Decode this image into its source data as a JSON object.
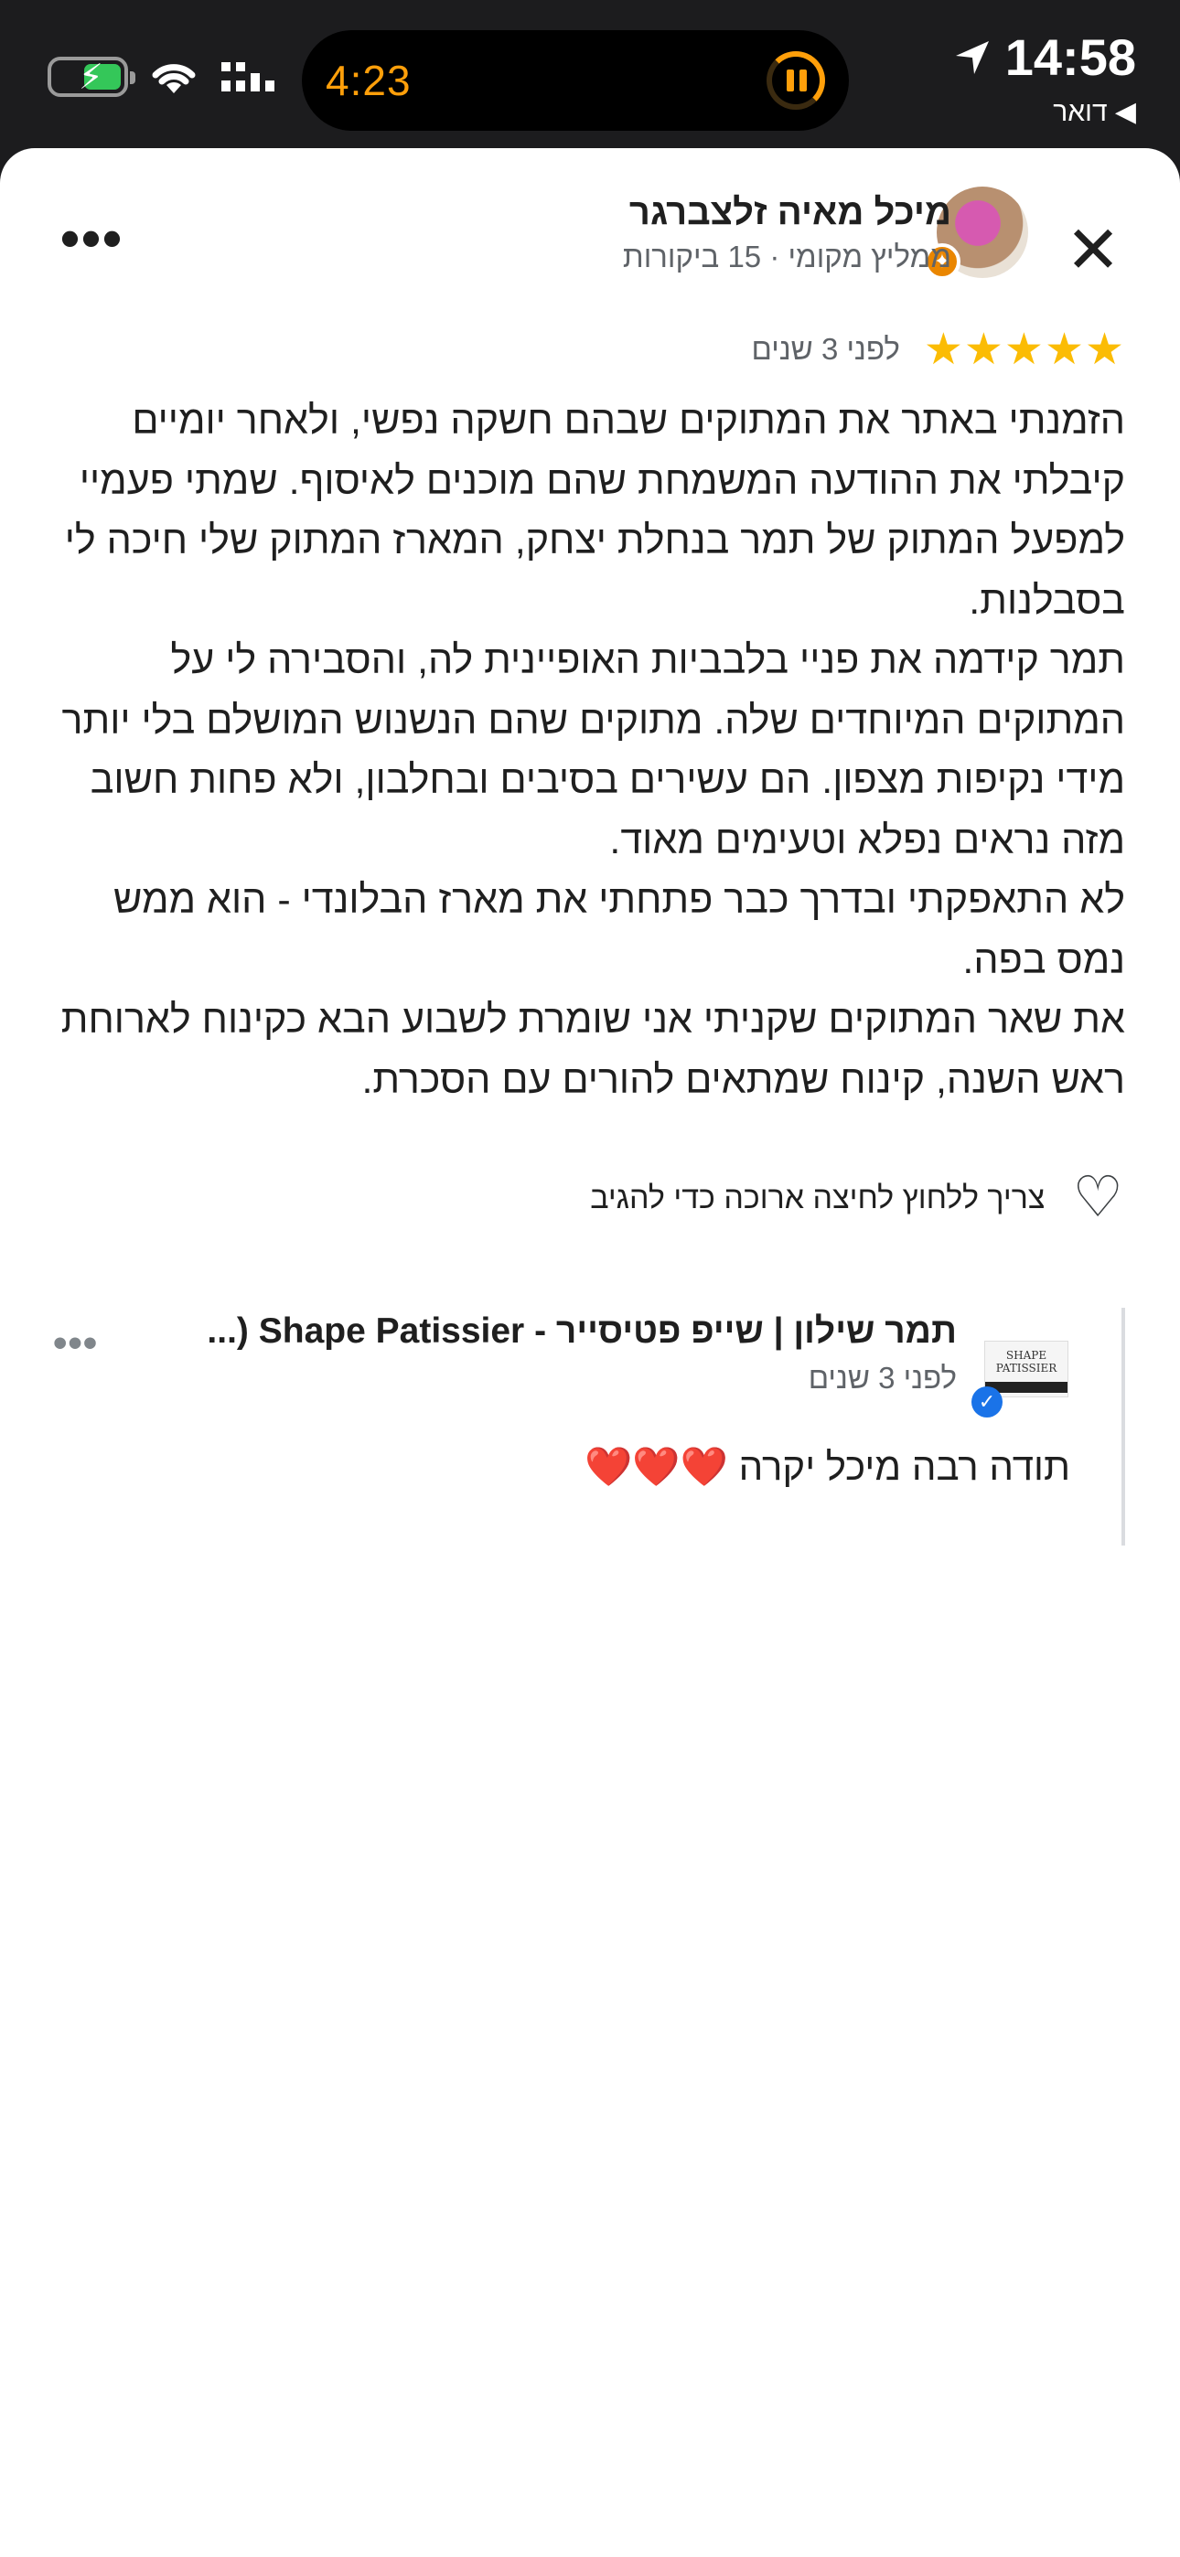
{
  "status_bar": {
    "time": "14:58",
    "back_app": "דואר",
    "timer": "4:23"
  },
  "review": {
    "author_name": "מיכל מאיה זלצברגר",
    "author_meta": "ממליץ מקומי · 15 ביקורות",
    "stars": "★★★★★",
    "rating": 5,
    "time_ago": "לפני 3 שנים",
    "paragraphs": [
      "הזמנתי באתר את המתוקים שבהם חשקה נפשי, ולאחר יומיים קיבלתי את ההודעה המשמחת שהם מוכנים לאיסוף. שמתי פעמיי למפעל המתוק של תמר בנחלת יצחק, המארז המתוק שלי חיכה לי בסבלנות.",
      "תמר קידמה את פניי בלבביות האופיינית לה, והסבירה לי על המתוקים המיוחדים שלה. מתוקים שהם הנשנוש המושלם בלי יותר מידי נקיפות מצפון. הם עשירים בסיבים ובחלבון, ולא פחות חשוב מזה נראים נפלא וטעימים מאוד.",
      "לא התאפקתי ובדרך כבר פתחתי את מארז הבלונדי - הוא ממש נמס בפה.",
      "את שאר המתוקים שקניתי אני שומרת לשבוע הבא כקינוח לארוחת ראש השנה, קינוח שמתאים להורים עם הסכרת."
    ],
    "like_hint": "צריך ללחוץ לחיצה ארוכה כדי להגיב"
  },
  "reply": {
    "owner_name": "תמר שילון | שייפ פטיסייר - Shape Patissier (...",
    "time_ago": "לפני 3 שנים",
    "text": "תודה רבה מיכל יקרה ❤️❤️❤️",
    "logo_text": "SHAPE PATISSIER"
  },
  "colors": {
    "star": "#fbbc04",
    "badge": "#ea8600",
    "verified": "#1a73e8",
    "island_accent": "#ff9f0a"
  }
}
